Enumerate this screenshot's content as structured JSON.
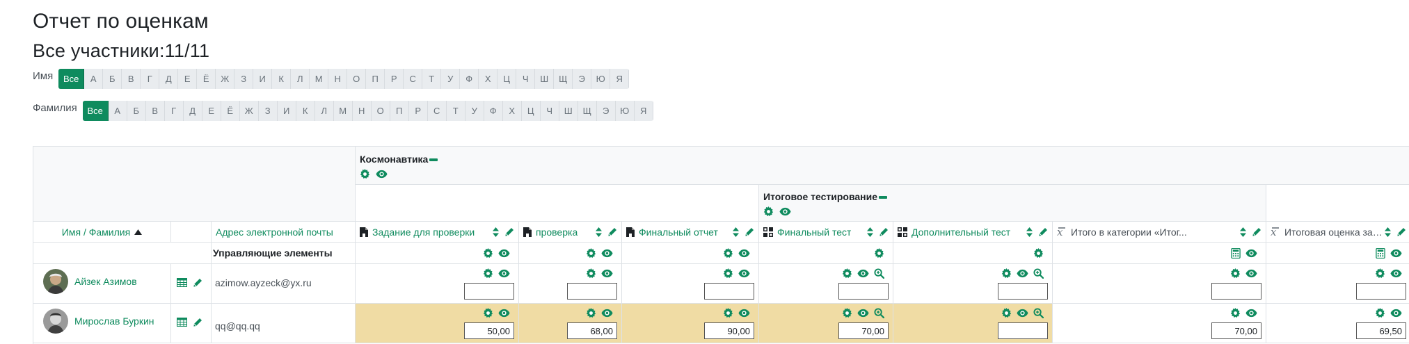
{
  "page": {
    "title": "Отчет по оценкам",
    "participants": "Все участники:11/11"
  },
  "initials": {
    "first_label": "Имя",
    "last_label": "Фамилия",
    "all_label": "Все",
    "letters": [
      "А",
      "Б",
      "В",
      "Г",
      "Д",
      "Е",
      "Ё",
      "Ж",
      "З",
      "И",
      "К",
      "Л",
      "М",
      "Н",
      "О",
      "П",
      "Р",
      "С",
      "Т",
      "У",
      "Ф",
      "Х",
      "Ц",
      "Ч",
      "Ш",
      "Щ",
      "Э",
      "Ю",
      "Я"
    ]
  },
  "table": {
    "category_main": "Космонавтика",
    "category_sub": "Итоговое тестирование",
    "col_name": "Имя / Фамилия",
    "col_email": "Адрес электронной почты",
    "items": [
      {
        "label": "Задание для проверки",
        "icon": "assignment-icon"
      },
      {
        "label": "проверка",
        "icon": "assignment-icon"
      },
      {
        "label": "Финальный отчет",
        "icon": "assignment-icon"
      },
      {
        "label": "Финальный тест",
        "icon": "quiz-icon"
      },
      {
        "label": "Дополнительный тест",
        "icon": "quiz-icon"
      },
      {
        "label": "Итого в категории «Итог...",
        "icon": "sum-icon"
      },
      {
        "label": "Итоговая оценка за курс",
        "icon": "sum-icon"
      }
    ],
    "controls_label": "Управляющие элементы",
    "students": [
      {
        "name": "Айзек Азимов",
        "email": "azimow.ayzeck@yx.ru",
        "grades": [
          "",
          "",
          "",
          "",
          "",
          "",
          ""
        ]
      },
      {
        "name": "Мирослав Буркин",
        "email": "qq@qq.qq",
        "grades": [
          "50,00",
          "68,00",
          "90,00",
          "70,00",
          "",
          "70,00",
          "69,50"
        ]
      }
    ]
  },
  "colors": {
    "accent": "#0f8b5e",
    "overridden": "#f0dca4",
    "border": "#dee2e6"
  }
}
